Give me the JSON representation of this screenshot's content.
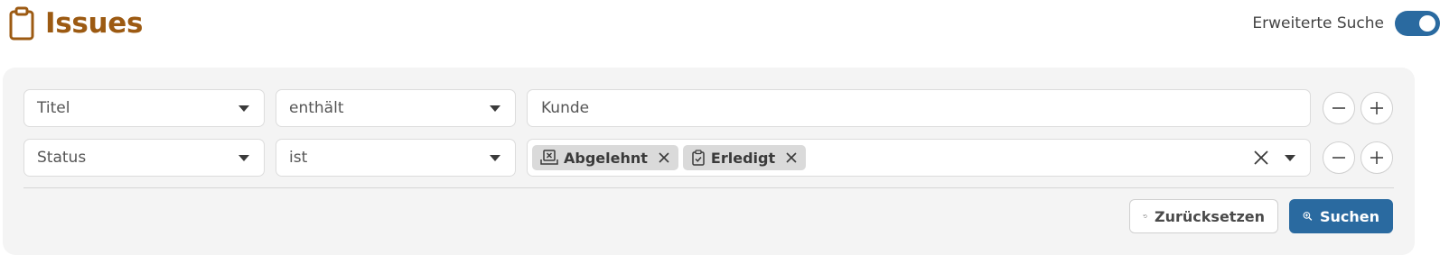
{
  "header": {
    "title": "Issues",
    "advanced_search_label": "Erweiterte Suche",
    "advanced_search_enabled": true
  },
  "filters": [
    {
      "field": "Titel",
      "operator": "enthält",
      "value_type": "text",
      "value": "Kunde"
    },
    {
      "field": "Status",
      "operator": "ist",
      "value_type": "multiselect",
      "chips": [
        {
          "label": "Abgelehnt",
          "icon": "rejected-icon"
        },
        {
          "label": "Erledigt",
          "icon": "clipboard-check-icon"
        }
      ]
    }
  ],
  "actions": {
    "reset_label": "Zurücksetzen",
    "search_label": "Suchen"
  },
  "colors": {
    "title": "#9c5a12",
    "primary": "#2a6aa0",
    "panel": "#f4f4f4",
    "chip": "#dadada"
  }
}
